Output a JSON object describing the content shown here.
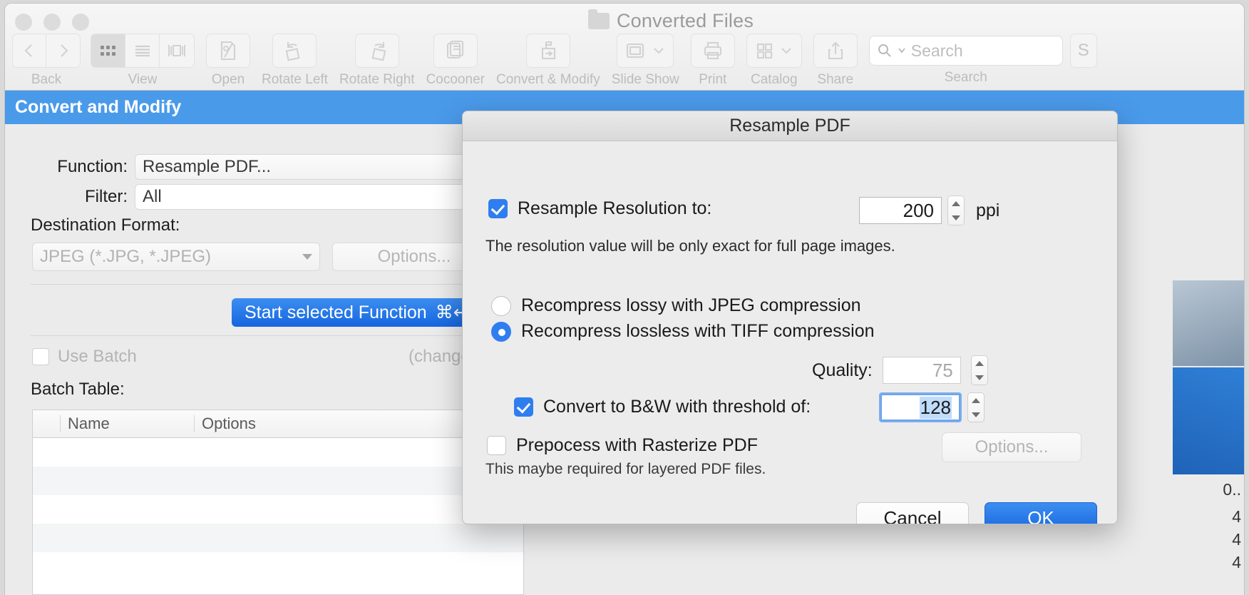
{
  "window": {
    "title": "Converted Files",
    "folder_icon": "folder-icon"
  },
  "toolbar": {
    "items": [
      {
        "label": "Back",
        "icon": "back-forward-nav-icon"
      },
      {
        "label": "View",
        "icon": "view-mode-segmented-icon"
      },
      {
        "label": "Open",
        "icon": "open-icon"
      },
      {
        "label": "Rotate Left",
        "icon": "rotate-left-icon"
      },
      {
        "label": "Rotate Right",
        "icon": "rotate-right-icon"
      },
      {
        "label": "Cocooner",
        "icon": "cocooner-icon"
      },
      {
        "label": "Convert & Modify",
        "icon": "convert-modify-icon"
      },
      {
        "label": "Slide Show",
        "icon": "slide-show-icon"
      },
      {
        "label": "Print",
        "icon": "print-icon"
      },
      {
        "label": "Catalog",
        "icon": "catalog-icon"
      },
      {
        "label": "Share",
        "icon": "share-icon"
      }
    ],
    "search": {
      "label": "Search",
      "placeholder": "Search",
      "value": "",
      "icon": "search-icon"
    },
    "overflow_label": "S"
  },
  "section": {
    "title": "Convert and Modify"
  },
  "pane": {
    "function_label": "Function:",
    "function_value": "Resample PDF...",
    "filter_label": "Filter:",
    "filter_value": "All",
    "destination_format_label": "Destination Format:",
    "destination_format_value": "JPEG (*.JPG, *.JPEG)",
    "destination_options_button": "Options...",
    "start_button": "Start selected Function",
    "start_button_shortcut": "⌘↩",
    "use_batch_label": "Use Batch",
    "changes_note": "(change",
    "batch_table_label": "Batch Table:",
    "table": {
      "columns": [
        "",
        "Name",
        "Options"
      ],
      "rows": [
        [],
        [],
        [],
        []
      ]
    }
  },
  "background_strip": {
    "lines": [
      "0..",
      "4",
      "4",
      "4"
    ]
  },
  "dialog": {
    "title": "Resample PDF",
    "resample_checkbox_label": "Resample Resolution to:",
    "resample_checked": true,
    "resample_value": "200",
    "resample_unit": "ppi",
    "resolution_note": "The resolution value will be only exact for full page images.",
    "radio_options": [
      {
        "label": "Recompress lossy with JPEG compression",
        "selected": false
      },
      {
        "label": "Recompress lossless with TIFF compression",
        "selected": true
      }
    ],
    "quality_label": "Quality:",
    "quality_value": "75",
    "quality_enabled": false,
    "bw_checkbox_label": "Convert to B&W with threshold of:",
    "bw_checked": true,
    "bw_value": "128",
    "bw_focused": true,
    "rasterize_checkbox_label": "Prepocess with Rasterize PDF",
    "rasterize_checked": false,
    "rasterize_options_button": "Options...",
    "rasterize_note": "This maybe required for layered PDF files.",
    "cancel_button": "Cancel",
    "ok_button": "OK"
  },
  "colors": {
    "accent_blue": "#2f7ef0",
    "section_blue": "#4a9aea",
    "selection_blue": "#bfdcfb",
    "window_bg": "#ececec",
    "pane_bg": "#ebebeb"
  }
}
